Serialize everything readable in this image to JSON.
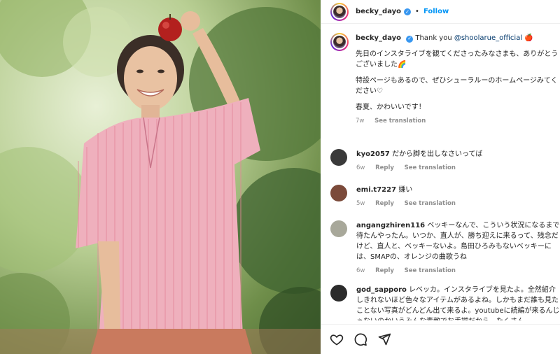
{
  "post_author": {
    "username": "becky_dayo",
    "follow_label": "Follow",
    "separator": "•"
  },
  "caption": {
    "username": "becky_dayo",
    "text_prefix": "Thank you ",
    "mention": "@shoolarue_official",
    "emoji": "🍎",
    "line2": "先日のインスタライブを観てくださったみなさまも、ありがとうございました🌈",
    "line3": "特設ページもあるので、ぜひシューラルーのホームページみてください♡",
    "line4": "春夏、かわいいです！",
    "time": "7w",
    "see_translation": "See translation"
  },
  "comments": [
    {
      "username": "kyo2057",
      "text": "だから脚を出しなさいってば",
      "time": "6w",
      "reply": "Reply",
      "see_translation": "See translation",
      "avatar_color": "#3a3a3a"
    },
    {
      "username": "emi.t7227",
      "text": "嫌い",
      "time": "5w",
      "reply": "Reply",
      "see_translation": "See translation",
      "avatar_color": "#7b4a3a"
    },
    {
      "username": "angangzhiren116",
      "text": "ベッキーなんで、こういう状況になるまで待たんやったん。いつか、直人が、勝ち迎えに来るって、残念だけど、直人と、ベッキーないよ。島田ひろみもないベッキーには、SMAPの、オレンジの曲歌うね",
      "time": "6w",
      "reply": "Reply",
      "see_translation": "See translation",
      "avatar_color": "#a8a89a"
    },
    {
      "username": "god_sapporo",
      "text": "レベッカ。インスタライブを見たよ。全然紹介しきれないほど色々なアイテムがあるよね。しかもまだ誰も見たことない写真がどんどん出て来るよ。youtubeに続編が来るんじゃないのかいうみんな素敵でお手揃だから、たくさん",
      "time": "",
      "reply": "",
      "see_translation": "",
      "avatar_color": "#2b2b2b"
    }
  ],
  "actions": {
    "like": "heart-icon",
    "comment": "comment-icon",
    "share": "share-icon"
  }
}
